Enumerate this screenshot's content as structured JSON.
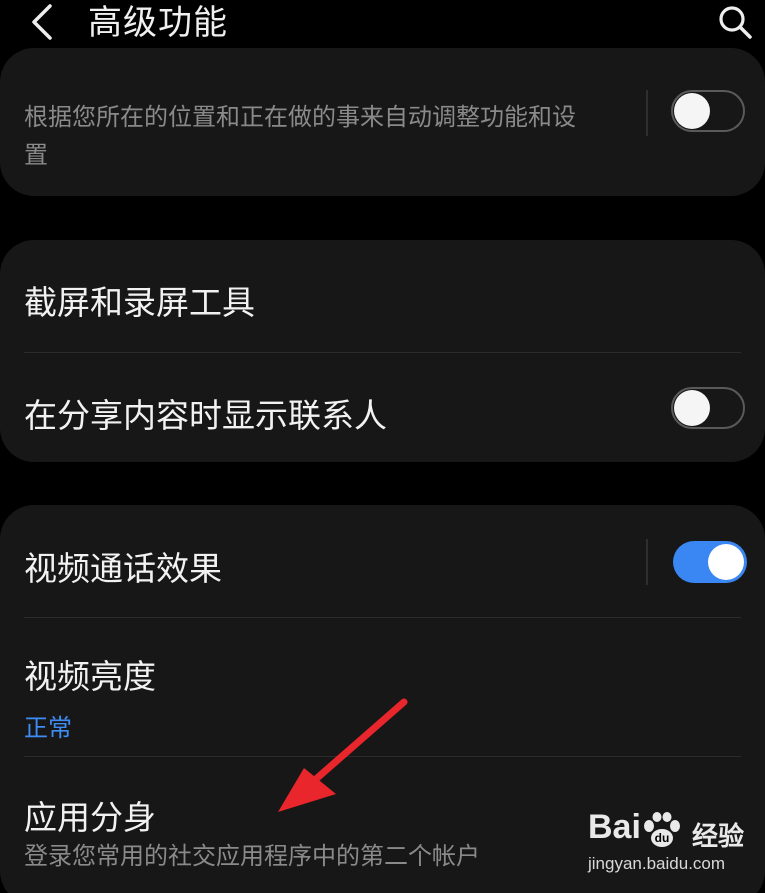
{
  "header": {
    "title": "高级功能"
  },
  "sections": [
    {
      "rows": [
        {
          "subtitle": "根据您所在的位置和正在做的事来自动调整功能和设置",
          "subtitle_line1": "根据您所在的位置和正在做的事来自动调整功能和设",
          "subtitle_line2": "置",
          "toggle": "off"
        }
      ]
    },
    {
      "rows": [
        {
          "label": "截屏和录屏工具"
        },
        {
          "label": "在分享内容时显示联系人",
          "toggle": "off"
        }
      ]
    },
    {
      "rows": [
        {
          "label": "视频通话效果",
          "toggle": "on"
        },
        {
          "label": "视频亮度",
          "value": "正常"
        },
        {
          "label": "应用分身",
          "subtitle": "登录您常用的社交应用程序中的第二个帐户"
        }
      ]
    }
  ],
  "annotation": {
    "arrow_color": "#e8262b"
  },
  "watermark": {
    "brand_left": "Bai",
    "brand_right": "经验",
    "url": "jingyan.baidu.com"
  },
  "colors": {
    "background": "#000000",
    "card": "#171717",
    "accent": "#3a86f2",
    "subtitle": "#8a8a8a"
  },
  "icons": {
    "back": "chevron-left-icon",
    "search": "search-icon"
  }
}
